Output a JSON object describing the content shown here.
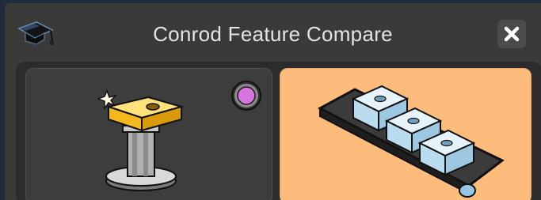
{
  "window": {
    "title": "Conrod Feature Compare",
    "close_icon": "close-icon",
    "app_icon": "graduation-cap-icon"
  },
  "tiles": [
    {
      "name": "single-feature",
      "icon": "part-on-pedestal-icon",
      "selected": false,
      "status_color": "#d874e0"
    },
    {
      "name": "conveyor-parts",
      "icon": "parts-on-conveyor-icon",
      "selected": true
    }
  ],
  "colors": {
    "window_bg": "#3a3a3a",
    "selected_tile": "#fdbb7c",
    "status_dot": "#d874e0"
  }
}
